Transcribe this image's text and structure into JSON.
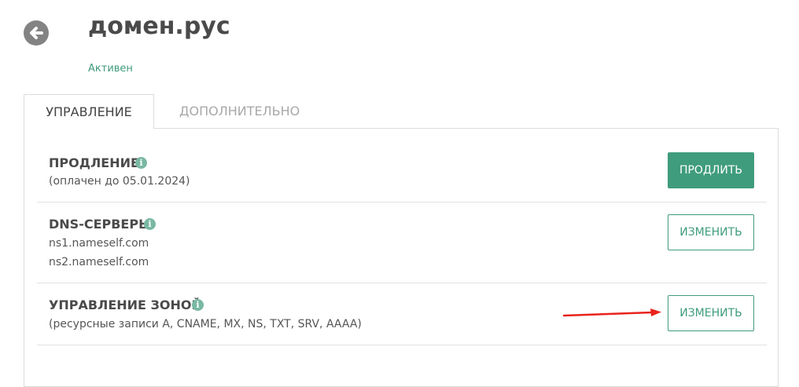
{
  "domain": {
    "name": "домен.рус",
    "status": "Активен"
  },
  "tabs": [
    {
      "label": "УПРАВЛЕНИЕ",
      "active": true
    },
    {
      "label": "ДОПОЛНИТЕЛЬНО",
      "active": false
    }
  ],
  "sections": {
    "renewal": {
      "title": "ПРОДЛЕНИЕ",
      "subtitle": "(оплачен до 05.01.2024)",
      "button": "ПРОДЛИТЬ"
    },
    "dns": {
      "title": "DNS-СЕРВЕРЫ",
      "servers": [
        "ns1.nameself.com",
        "ns2.nameself.com"
      ],
      "button": "ИЗМЕНИТЬ"
    },
    "zone": {
      "title": "УПРАВЛЕНИЕ ЗОНОЙ",
      "subtitle": "(ресурсные записи A, CNAME, MX, NS, TXT, SRV, AAAA)",
      "button": "ИЗМЕНИТЬ"
    }
  },
  "icons": {
    "back": "arrow-left-circle",
    "info": "info-circle",
    "annotation": "red-arrow"
  },
  "colors": {
    "accent": "#3f9c7d",
    "status": "#3e9a7b",
    "annotation_arrow": "#e8231c"
  }
}
